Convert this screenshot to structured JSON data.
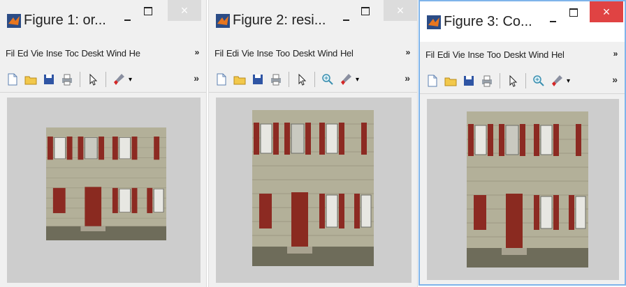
{
  "windows": [
    {
      "title": "Figure 1: or...",
      "menu": [
        "Fil",
        "Ed",
        "Vie",
        "Inse",
        "Toc",
        "Deskt",
        "Wind",
        "He"
      ],
      "close_glyph": "×"
    },
    {
      "title": "Figure 2: resi...",
      "menu": [
        "Fil",
        "Edi",
        "Vie",
        "Inse",
        "Too",
        "Deskt",
        "Wind",
        "Hel"
      ],
      "close_glyph": "×"
    },
    {
      "title": "Figure 3: Co...",
      "menu": [
        "Fil",
        "Edi",
        "Vie",
        "Inse",
        "Too",
        "Deskt",
        "Wind",
        "Hel"
      ],
      "close_glyph": "×"
    }
  ],
  "menu_overflow": "»",
  "toolbar_overflow": "»",
  "toolbar_icons": [
    "new-file-icon",
    "open-folder-icon",
    "save-icon",
    "print-icon",
    "pointer-icon",
    "zoom-in-icon",
    "brush-icon"
  ],
  "colors": {
    "active_border": "#7fb4ea",
    "close_active": "#e04343",
    "close_inactive": "#dcdcdc",
    "canvas": "#cdcdcd"
  }
}
